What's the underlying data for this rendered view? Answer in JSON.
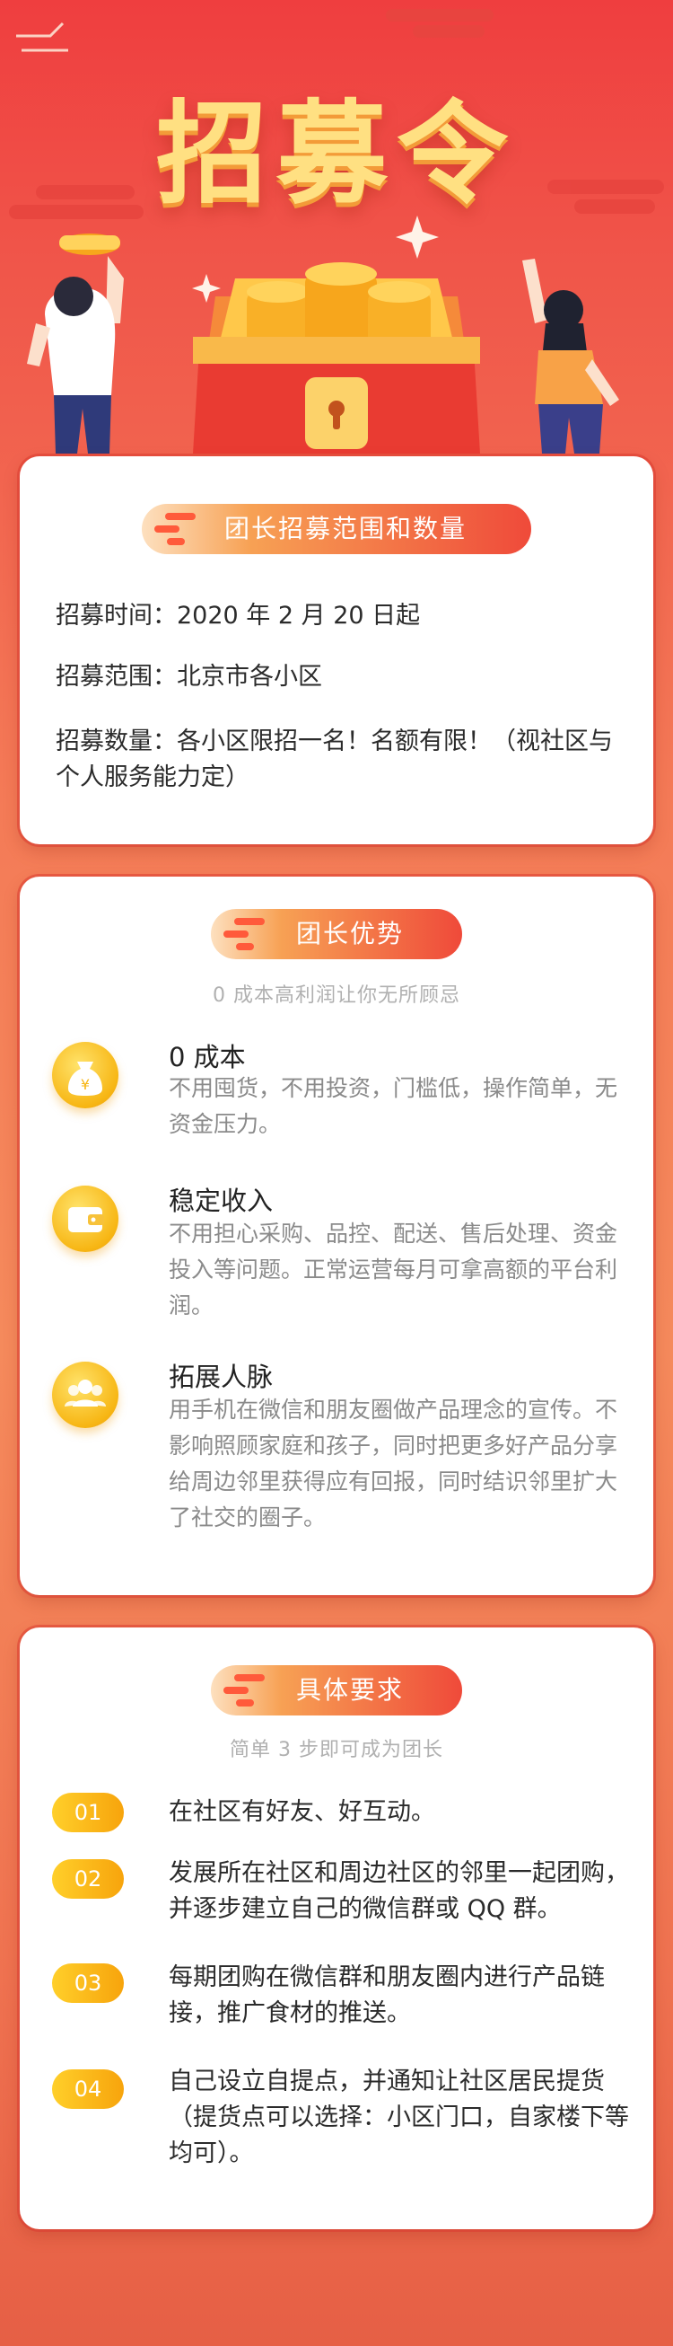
{
  "hero": {
    "title": "招募令"
  },
  "section1": {
    "heading": "团长招募范围和数量",
    "lines": [
      "招募时间：2020 年 2 月 20 日起",
      "招募范围：北京市各小区",
      "招募数量：各小区限招一名！名额有限！（视社区与个人服务能力定）"
    ]
  },
  "section2": {
    "heading": "团长优势",
    "subtitle": "0 成本高利润让你无所顾忌",
    "items": [
      {
        "icon": "money-bag-icon",
        "title": "0 成本",
        "text": "不用囤货，不用投资，门槛低，操作简单，无资金压力。"
      },
      {
        "icon": "wallet-icon",
        "title": "稳定收入",
        "text": "不用担心采购、品控、配送、售后处理、资金投入等问题。正常运营每月可拿高额的平台利润。"
      },
      {
        "icon": "people-icon",
        "title": "拓展人脉",
        "text": "用手机在微信和朋友圈做产品理念的宣传。不影响照顾家庭和孩子，同时把更多好产品分享给周边邻里获得应有回报，同时结识邻里扩大了社交的圈子。"
      }
    ]
  },
  "section3": {
    "heading": "具体要求",
    "subtitle": "简单 3 步即可成为团长",
    "steps": [
      {
        "num": "01",
        "text": "在社区有好友、好互动。"
      },
      {
        "num": "02",
        "text": "发展所在社区和周边社区的邻里一起团购，并逐步建立自己的微信群或 QQ 群。"
      },
      {
        "num": "03",
        "text": "每期团购在微信群和朋友圈内进行产品链接，推广食材的推送。"
      },
      {
        "num": "04",
        "text": "自己设立自提点，并通知让社区居民提货（提货点可以选择：小区门口，自家楼下等均可）。"
      }
    ]
  },
  "colors": {
    "accent_red": "#ef3e3f",
    "gold": "#f7b614",
    "pill_end": "#ef4a3a"
  }
}
